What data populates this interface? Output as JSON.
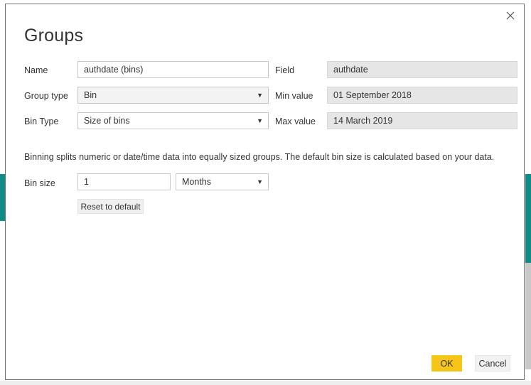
{
  "dialog": {
    "title": "Groups",
    "close_icon": "close-icon"
  },
  "left_form": {
    "name": {
      "label": "Name",
      "value": "authdate (bins)"
    },
    "group_type": {
      "label": "Group type",
      "value": "Bin",
      "caret": "▼"
    },
    "bin_type": {
      "label": "Bin Type",
      "value": "Size of bins",
      "caret": "▼"
    }
  },
  "right_form": {
    "field": {
      "label": "Field",
      "value": "authdate"
    },
    "min_value": {
      "label": "Min value",
      "value": "01 September 2018"
    },
    "max_value": {
      "label": "Max value",
      "value": "14 March 2019"
    }
  },
  "description": "Binning splits numeric or date/time data into equally sized groups. The default bin size is calculated based on your data.",
  "bin_size": {
    "label": "Bin size",
    "value": "1",
    "unit": "Months",
    "unit_caret": "▼",
    "reset_label": "Reset to default"
  },
  "footer": {
    "ok_label": "OK",
    "cancel_label": "Cancel"
  },
  "colors": {
    "accent_ok": "#f5c518",
    "background_strip": "#0e8c85",
    "readonly_field": "#e6e6e6",
    "field_border": "#c8c8c8"
  }
}
